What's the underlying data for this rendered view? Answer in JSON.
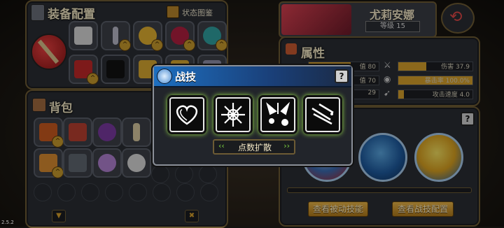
{
  "equipment": {
    "title": "装备配置",
    "status_book_label": "状态图鉴"
  },
  "backpack": {
    "title": "背包"
  },
  "character": {
    "name": "尤莉安娜",
    "level_label": "等级 15"
  },
  "attributes": {
    "title": "属性",
    "left_stats": [
      {
        "label": "值",
        "value": "80",
        "fill": 0.6
      },
      {
        "label": "值",
        "value": "70",
        "fill": 0.55
      },
      {
        "label": "",
        "value": "29",
        "fill": 0.3
      }
    ],
    "right_stats": [
      {
        "label": "伤害",
        "value": "37.9",
        "fill": 0.38
      },
      {
        "label": "暴击率",
        "value": "100.0%",
        "fill": 1.0
      },
      {
        "label": "攻击速度",
        "value": "4.0",
        "fill": 0.08
      }
    ]
  },
  "skills_panel": {
    "passive_button": "查看被动技能",
    "config_button": "查看战技配置"
  },
  "dialog": {
    "title": "战技",
    "help": "?",
    "expand_button": "点数扩散",
    "skill_names": [
      "heart-skill",
      "snowflake-skill",
      "frost-burst-skill",
      "ice-shards-skill"
    ]
  },
  "version": "2.5.2",
  "colors": {
    "accent_green": "#9be04a",
    "gold": "#d6a02c",
    "panel_border": "#6d5b34"
  }
}
